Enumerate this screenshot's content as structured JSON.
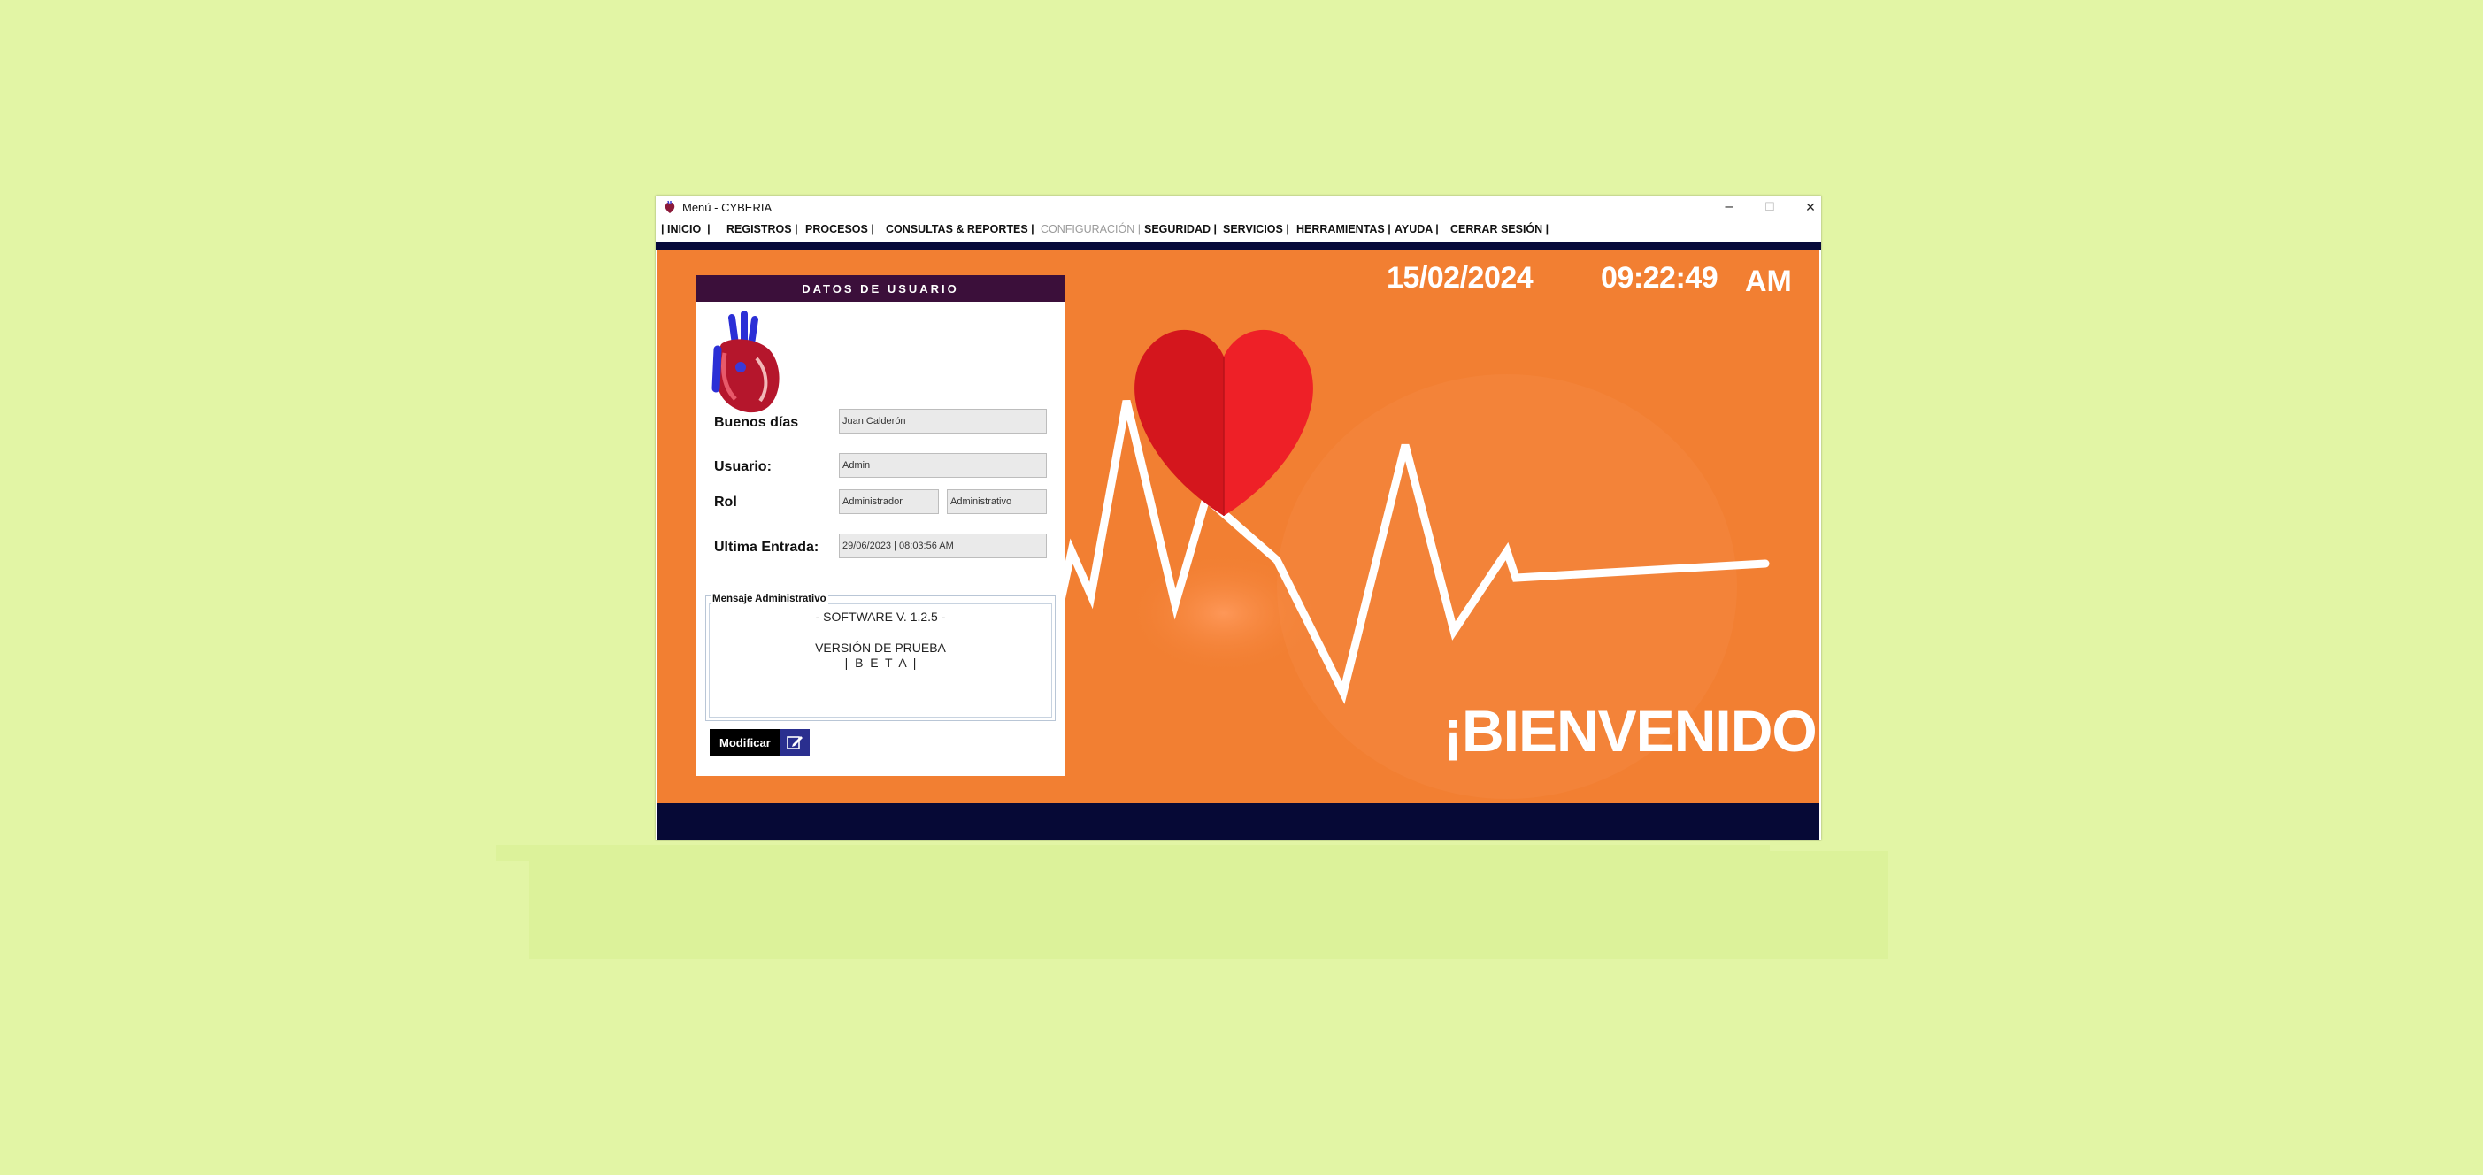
{
  "window": {
    "title": "Menú - CYBERIA",
    "controls": {
      "minimize": "–",
      "maximize": "☐",
      "close": "✕"
    }
  },
  "menu": {
    "items": [
      {
        "label": "| INICIO  |",
        "enabled": true
      },
      {
        "label": "REGISTROS |",
        "enabled": true
      },
      {
        "label": "PROCESOS |",
        "enabled": true
      },
      {
        "label": "CONSULTAS & REPORTES |",
        "enabled": true
      },
      {
        "label": "CONFIGURACIÓN |",
        "enabled": false
      },
      {
        "label": "SEGURIDAD |",
        "enabled": true
      },
      {
        "label": "SERVICIOS |",
        "enabled": true
      },
      {
        "label": "HERRAMIENTAS |",
        "enabled": true
      },
      {
        "label": "AYUDA |",
        "enabled": true
      },
      {
        "label": "CERRAR SESIÓN |",
        "enabled": true
      }
    ]
  },
  "clock": {
    "date": "15/02/2024",
    "time": "09:22:49",
    "ampm": "AM"
  },
  "welcome": "¡BIENVENIDO!",
  "user_panel": {
    "title": "DATOS DE USUARIO",
    "greeting_label": "Buenos días",
    "greeting_value": "Juan Calderón",
    "user_label": "Usuario:",
    "user_value": "Admin",
    "role_label": "Rol",
    "role_value": "Administrador",
    "role_area_value": "Administrativo",
    "last_entry_label": "Ultima Entrada:",
    "last_entry_value": "29/06/2023 | 08:03:56 AM",
    "message_legend": "Mensaje Administrativo",
    "message_lines": [
      "- SOFTWARE V. 1.2.5 -",
      "",
      "VERSIÓN DE PRUEBA",
      "|  B  E  T  A  |"
    ],
    "modify_button": "Modificar"
  },
  "colors": {
    "background": "#e2f5a5",
    "main_orange": "#f27f32",
    "navy": "#060936",
    "panel_header": "#3b0f3a",
    "heart_red": "#e81d25",
    "button_icon_blue": "#2a2f8f"
  },
  "icons": {
    "app": "cyberia-app-icon",
    "heart_logo": "anatomical-heart-icon",
    "modify": "edit-icon",
    "decoration": "paper-heart-ecg-illustration"
  }
}
